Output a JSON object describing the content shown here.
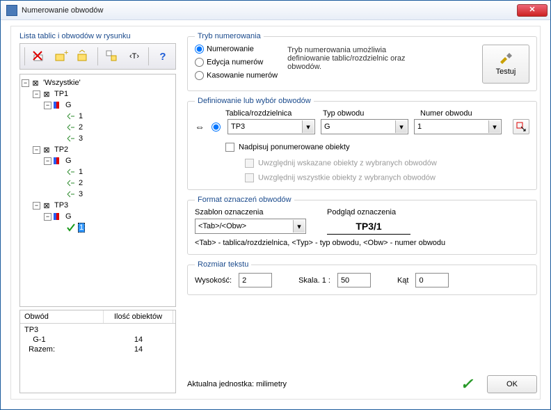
{
  "window": {
    "title": "Numerowanie obwodów"
  },
  "left_title": "Lista tablic i obwodów w rysunku",
  "toolbar": {
    "btn_exclude": "exclude-x",
    "btn_add": "add",
    "btn_add2": "add2",
    "btn_group": "group",
    "btn_text": "<T>",
    "btn_help": "?"
  },
  "tree": {
    "root": "'Wszystkie'",
    "tp1": "TP1",
    "tp2": "TP2",
    "tp3": "TP3",
    "g": "G",
    "n1": "1",
    "n2": "2",
    "n3": "3",
    "sel": "1"
  },
  "list": {
    "hdr1": "Obwód",
    "hdr2": "Ilość obiektów",
    "r1c1": "TP3",
    "r2c1": "    G-1",
    "r2c2": "14",
    "r3c1": "  Razem:",
    "r3c2": "14"
  },
  "tryb": {
    "legend": "Tryb numerowania",
    "opt1": "Numerowanie",
    "opt2": "Edycja numerów",
    "opt3": "Kasowanie numerów",
    "desc": "Tryb numerowania umożliwia definiowanie tablic/rozdzielnic oraz obwodów.",
    "test": "Testuj"
  },
  "def": {
    "legend": "Definiowanie lub wybór obwodów",
    "swap": "⇔",
    "l1": "Tablica/rozdzielnica",
    "l2": "Typ obwodu",
    "l3": "Numer obwodu",
    "v1": "TP3",
    "v2": "G",
    "v3": "1",
    "chk1": "Nadpisuj ponumerowane obiekty",
    "chk2": "Uwzględnij wskazane obiekty z wybranych obwodów",
    "chk3": "Uwzględnij wszystkie obiekty z wybranych obwodów"
  },
  "fmt": {
    "legend": "Format oznaczeń obwodów",
    "l1": "Szablon oznaczenia",
    "l2": "Podgląd oznaczenia",
    "template": "<Tab>/<Obw>",
    "preview": "TP3/1",
    "legend2": "<Tab> - tablica/rozdzielnica, <Typ> - typ obwodu, <Obw> - numer obwodu"
  },
  "size": {
    "legend": "Rozmiar tekstu",
    "l1": "Wysokość:",
    "v1": "2",
    "l2": "Skala.  1 :",
    "v2": "50",
    "l3": "Kąt",
    "v3": "0"
  },
  "footer": {
    "unit": "Aktualna jednostka: milimetry",
    "ok": "OK"
  }
}
